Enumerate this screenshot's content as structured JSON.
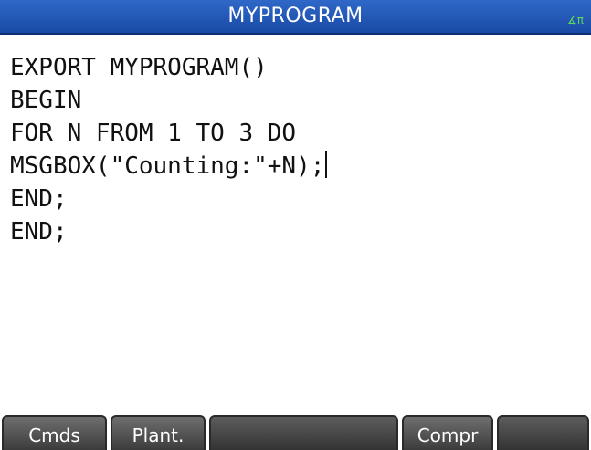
{
  "title_bar": {
    "title": "MYPROGRAM",
    "angle_indicator": "∡π"
  },
  "editor": {
    "lines": [
      "EXPORT MYPROGRAM()",
      "BEGIN",
      "FOR N FROM 1 TO 3 DO",
      "MSGBOX(\"Counting:\"+N);",
      "END;",
      "END;"
    ],
    "cursor_line": 3
  },
  "softkeys": {
    "key1": "Cmds",
    "key2": "Plant.",
    "key3": "",
    "key4": "Compr",
    "key5": ""
  },
  "colors": {
    "title_bar": "#2458b8",
    "softkey": "#505050",
    "text": "#111111"
  }
}
